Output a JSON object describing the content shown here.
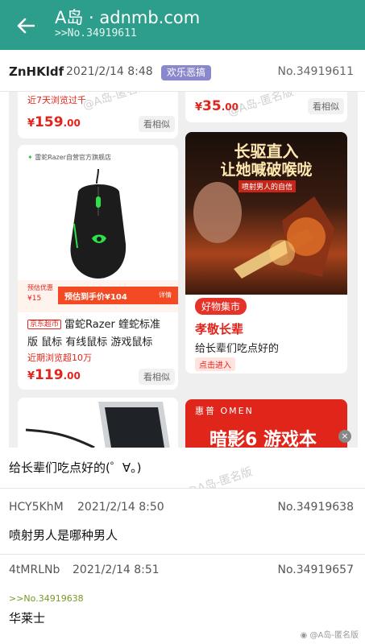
{
  "app": {
    "title": "A岛 · adnmb.com",
    "thread_ref": ">>No.34919611",
    "accent": "#2e9e8c"
  },
  "post": {
    "uid": "ZnHKldf",
    "time": "2021/2/14 8:48",
    "tag": "欢乐恶搞",
    "no": "No.34919611",
    "text": "给长辈们吃点好的(゜∀。)"
  },
  "screenshot": {
    "top_left": {
      "note": "近7天浏览过千",
      "price_symbol": "¥",
      "price": "159",
      "price_dec": ".00",
      "similar": "看相似"
    },
    "top_right": {
      "price_symbol": "¥",
      "price": "35",
      "price_dec": ".00",
      "similar": "看相似"
    },
    "razer": {
      "store": "雷蛇Razer自营官方旗舰店",
      "promo_label": "预估优惠",
      "promo_amount": "¥15",
      "promo_price": "预估到手价¥104",
      "promo_tag": "详情",
      "shop_badge": "京东超市",
      "name": "雷蛇Razer 蝰蛇标准版 鼠标 有线鼠标 游戏鼠标",
      "views": "近期浏览超10万",
      "price_symbol": "¥",
      "price": "119",
      "price_dec": ".00",
      "similar": "看相似"
    },
    "ad": {
      "headline1": "长驱直入",
      "headline2": "让她喊破喉咙",
      "tagline": "喷射男人的自信",
      "badge": "好物集市",
      "title": "孝敬长辈",
      "desc": "给长辈们吃点好的",
      "cta": "点击进入"
    },
    "bottom_right": {
      "brand": "惠普 OMEN",
      "slogan": "暗影6 游戏本"
    }
  },
  "replies": [
    {
      "uid": "HCY5KhM",
      "time": "2021/2/14 8:50",
      "no": "No.34919638",
      "quote": "",
      "text": "喷射男人是哪种男人"
    },
    {
      "uid": "4tMRLNb",
      "time": "2021/2/14 8:51",
      "no": "No.34919657",
      "quote": ">>No.34919638",
      "text": "华莱士"
    }
  ],
  "watermarks": [
    "@A岛-匿名版",
    "@A岛-匿名版",
    "@A岛-匿名版"
  ],
  "weibo_watermark": "@A岛-匿名版"
}
